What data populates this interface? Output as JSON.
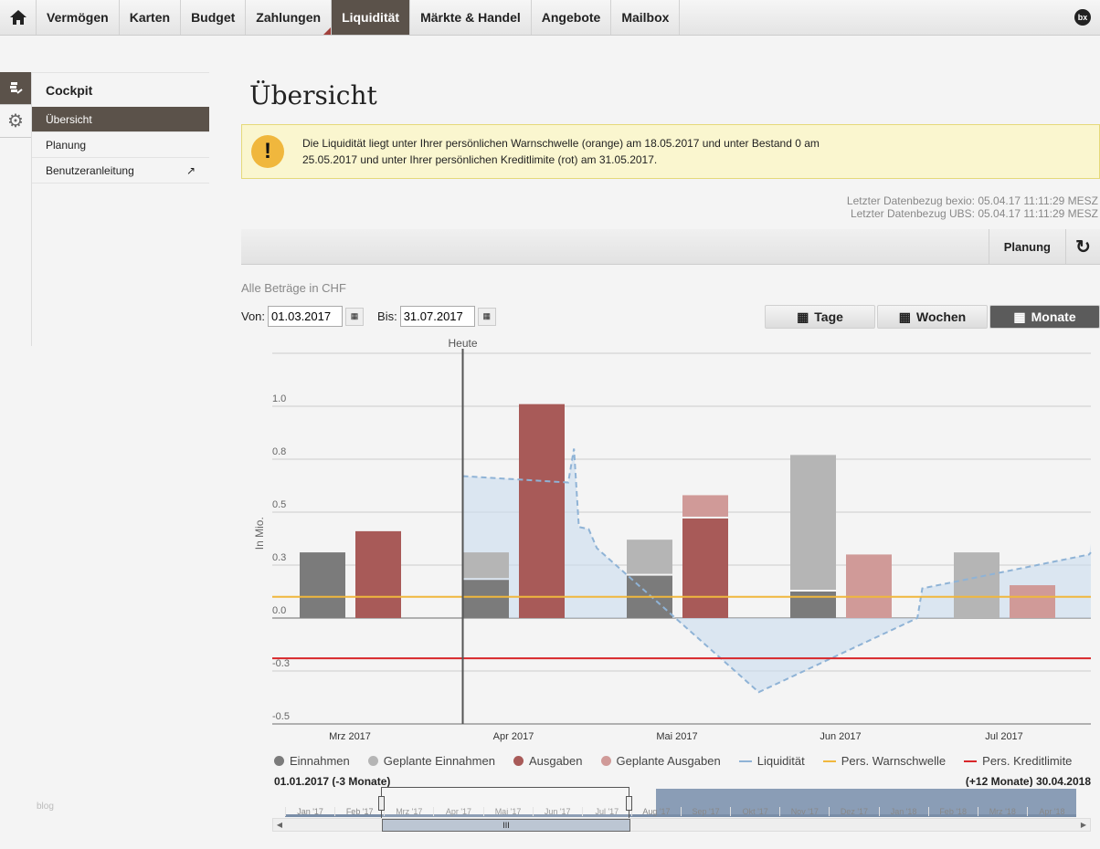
{
  "nav": {
    "items": [
      {
        "label": "Vermögen"
      },
      {
        "label": "Karten"
      },
      {
        "label": "Budget"
      },
      {
        "label": "Zahlungen"
      },
      {
        "label": "Liquidität"
      },
      {
        "label": "Märkte & Handel"
      },
      {
        "label": "Angebote"
      },
      {
        "label": "Mailbox"
      }
    ],
    "brand": "bx"
  },
  "sidebar": {
    "title": "Cockpit",
    "items": [
      {
        "label": "Übersicht"
      },
      {
        "label": "Planung"
      },
      {
        "label": "Benutzeranleitung"
      }
    ],
    "footer": "blog"
  },
  "page": {
    "title": "Übersicht",
    "alert": {
      "line1": "Die Liquidität liegt unter Ihrer persönlichen Warnschwelle (orange) am 18.05.2017 und unter Bestand 0 am",
      "line2": "25.05.2017 und unter Ihrer persönlichen Kreditlimite (rot) am 31.05.2017."
    },
    "datenbezug": [
      "Letzter Datenbezug bexio: 05.04.17 11:11:29 MESZ",
      "Letzter Datenbezug UBS: 05.04.17 11:11:29 MESZ"
    ],
    "toolbar": {
      "planung": "Planung"
    },
    "betraege": "Alle Beträge in CHF",
    "von_label": "Von:",
    "von": "01.03.2017",
    "bis_label": "Bis:",
    "bis": "31.07.2017",
    "periods": [
      "Tage",
      "Wochen",
      "Monate"
    ]
  },
  "chart_data": {
    "type": "bar",
    "ylabel": "In Mio.",
    "ylim": [
      -0.5,
      1.25
    ],
    "yticks": [
      {
        "v": 1.0,
        "label": "1.0"
      },
      {
        "v": 0.75,
        "label": "0.8"
      },
      {
        "v": 0.5,
        "label": "0.5"
      },
      {
        "v": 0.25,
        "label": "0.3"
      },
      {
        "v": 0,
        "label": "0.0"
      },
      {
        "v": -0.25,
        "label": "-0.3"
      },
      {
        "v": -0.5,
        "label": "-0.5"
      }
    ],
    "categories": [
      "Mrz 2017",
      "Apr 2017",
      "Mai 2017",
      "Jun 2017",
      "Jul 2017"
    ],
    "today_label": "Heute",
    "today_month": 1.19,
    "series": [
      {
        "name": "Einnahmen",
        "color": "#7b7b7b",
        "values": [
          0.31,
          0.18,
          0.2,
          0.125,
          0
        ]
      },
      {
        "name": "Geplante Einnahmen",
        "color": "#b5b5b5",
        "values": [
          0,
          0.13,
          0.17,
          0.645,
          0.31
        ]
      },
      {
        "name": "Ausgaben",
        "color": "#a85a58",
        "values": [
          0.41,
          1.01,
          0.47,
          0,
          0
        ]
      },
      {
        "name": "Geplante Ausgaben",
        "color": "#d09a98",
        "values": [
          0,
          0,
          0.11,
          0.3,
          0.155
        ]
      }
    ],
    "liquiditaet": {
      "name": "Liquidität",
      "color": "#8fb3d6",
      "points": [
        [
          1.19,
          0.67
        ],
        [
          1.835,
          0.64
        ],
        [
          1.87,
          0.8
        ],
        [
          1.9,
          0.43
        ],
        [
          1.96,
          0.42
        ],
        [
          2.01,
          0.33
        ],
        [
          3.0,
          -0.35
        ],
        [
          3.97,
          0.0
        ],
        [
          4.0,
          0.14
        ],
        [
          5.02,
          0.3
        ]
      ]
    },
    "warnschwelle": {
      "name": "Pers. Warnschwelle",
      "color": "#f0b73d",
      "value": 0.1
    },
    "kreditlimite": {
      "name": "Pers. Kreditlimite",
      "color": "#d8262a",
      "value": -0.19
    }
  },
  "navigator": {
    "start": "01.01.2017 (-3 Monate)",
    "end": "(+12 Monate) 30.04.2018",
    "months": [
      "Jan '17",
      "Feb '17",
      "Mrz '17",
      "Apr '17",
      "Mai '17",
      "Jun '17",
      "Jul '17",
      "Aug '17",
      "Sep '17",
      "Okt '17",
      "Nov '17",
      "Dez '17",
      "Jan '18",
      "Feb '18",
      "Mrz '18",
      "Apr '18"
    ],
    "thumb": "III"
  }
}
